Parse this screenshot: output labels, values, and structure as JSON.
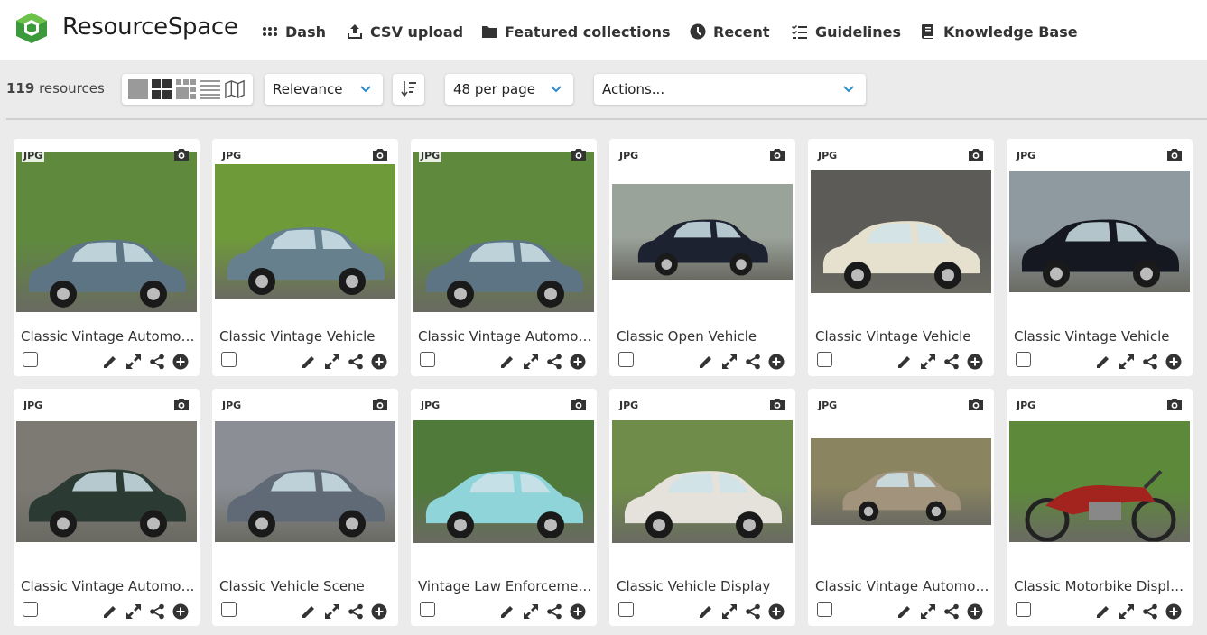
{
  "app": {
    "brand": "ResourceSpace",
    "accent": "#3c9a3c"
  },
  "nav": [
    {
      "label": "Dash",
      "icon": "dash-grid-icon"
    },
    {
      "label": "CSV upload",
      "icon": "upload-icon"
    },
    {
      "label": "Featured collections",
      "icon": "folder-icon"
    },
    {
      "label": "Recent",
      "icon": "clock-icon"
    },
    {
      "label": "Guidelines",
      "icon": "checklist-icon"
    },
    {
      "label": "Knowledge Base",
      "icon": "book-icon"
    }
  ],
  "toolbar": {
    "count_number": "119",
    "count_label": " resources",
    "view_modes": [
      "xlarge-thumbs",
      "large-thumbs",
      "small-thumbs",
      "list",
      "map"
    ],
    "sort_selected": "Relevance",
    "per_page_selected": "48 per page",
    "actions_selected": "Actions..."
  },
  "resources": [
    {
      "type": "JPG",
      "title": "Classic Vintage Automob..."
    },
    {
      "type": "JPG",
      "title": "Classic Vintage Vehicle"
    },
    {
      "type": "JPG",
      "title": "Classic Vintage Automob..."
    },
    {
      "type": "JPG",
      "title": "Classic Open Vehicle"
    },
    {
      "type": "JPG",
      "title": "Classic Vintage Vehicle"
    },
    {
      "type": "JPG",
      "title": "Classic Vintage Vehicle"
    },
    {
      "type": "JPG",
      "title": "Classic Vintage Automob..."
    },
    {
      "type": "JPG",
      "title": "Classic Vehicle Scene"
    },
    {
      "type": "JPG",
      "title": "Vintage Law Enforcemen..."
    },
    {
      "type": "JPG",
      "title": "Classic Vehicle Display"
    },
    {
      "type": "JPG",
      "title": "Classic Vintage Automob..."
    },
    {
      "type": "JPG",
      "title": "Classic Motorbike Displa..."
    }
  ]
}
